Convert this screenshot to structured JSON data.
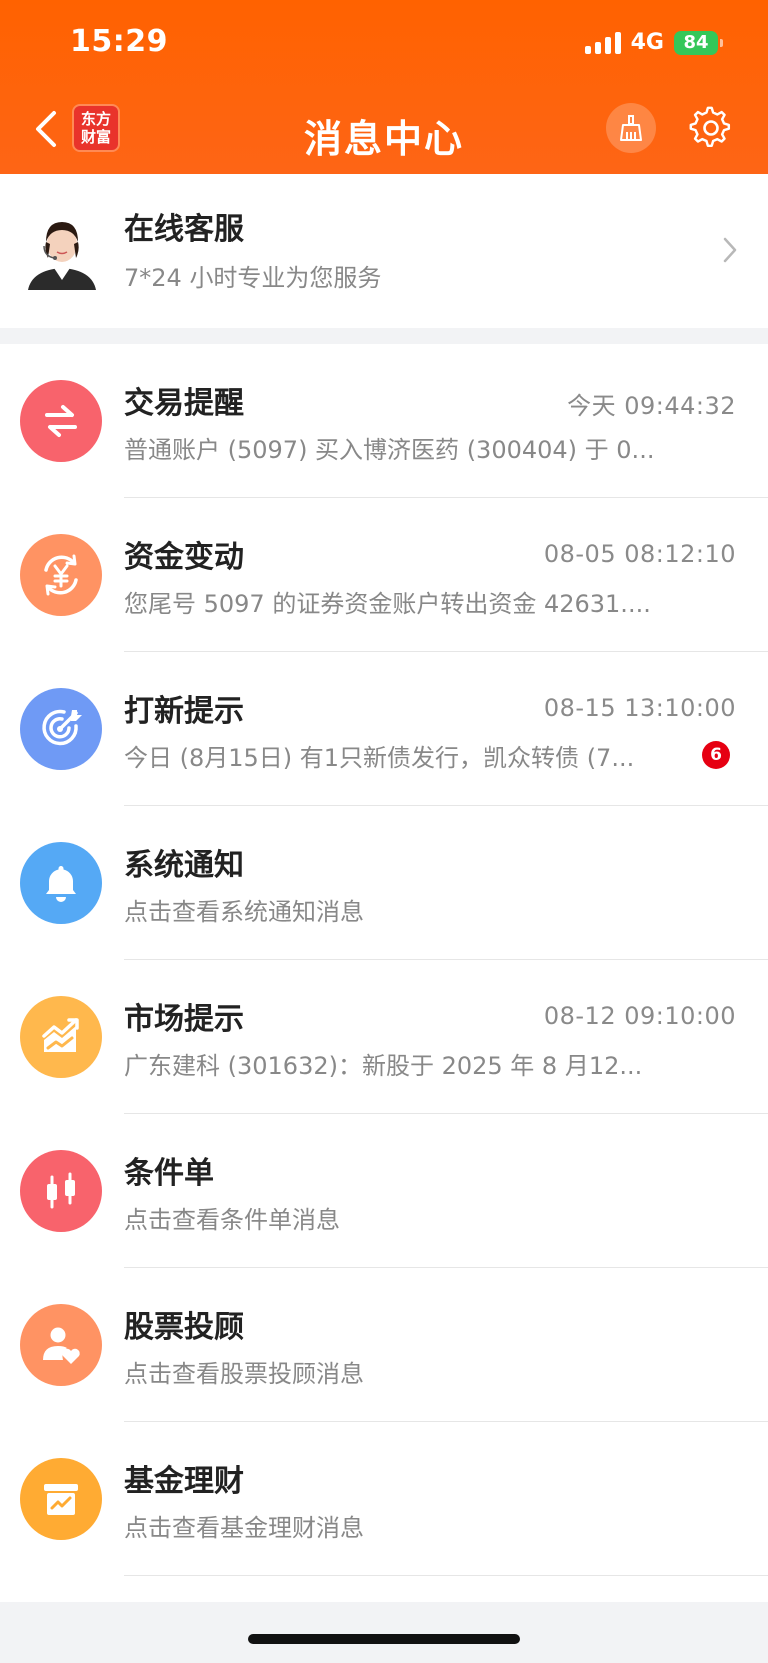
{
  "status_bar": {
    "time": "15:29",
    "network": "4G",
    "battery": "84"
  },
  "header": {
    "title": "消息中心",
    "logo_line1": "东方",
    "logo_line2": "财富",
    "icons": {
      "back": "chevron-left-icon",
      "clean": "broom-icon",
      "settings": "gear-icon"
    }
  },
  "service": {
    "title": "在线客服",
    "subtitle": "7*24 小时专业为您服务"
  },
  "messages": [
    {
      "title": "交易提醒",
      "time": "今天 09:44:32",
      "text": "普通账户 (5097) 买入博济医药 (300404) 于 0...",
      "icon": "swap-arrows-icon",
      "color": "#f8636c"
    },
    {
      "title": "资金变动",
      "time": "08-05 08:12:10",
      "text": "您尾号 5097 的证券资金账户转出资金 42631....",
      "icon": "yuan-refresh-icon",
      "color": "#ff9363"
    },
    {
      "title": "打新提示",
      "time": "08-15 13:10:00",
      "text": "今日 (8月15日) 有1只新债发行，凯众转债 (7...",
      "icon": "target-icon",
      "color": "#6f9af5",
      "badge": "6"
    },
    {
      "title": "系统通知",
      "time": "",
      "text": "点击查看系统通知消息",
      "icon": "bell-icon",
      "color": "#55a9f5"
    },
    {
      "title": "市场提示",
      "time": "08-12 09:10:00",
      "text": "广东建科 (301632)：新股于 2025 年 8 月12...",
      "icon": "chart-up-icon",
      "color": "#ffb84d"
    },
    {
      "title": "条件单",
      "time": "",
      "text": "点击查看条件单消息",
      "icon": "candlestick-icon",
      "color": "#f8636c"
    },
    {
      "title": "股票投顾",
      "time": "",
      "text": "点击查看股票投顾消息",
      "icon": "advisor-icon",
      "color": "#ff9363"
    },
    {
      "title": "基金理财",
      "time": "",
      "text": "点击查看基金理财消息",
      "icon": "fund-box-icon",
      "color": "#ffab33"
    }
  ]
}
